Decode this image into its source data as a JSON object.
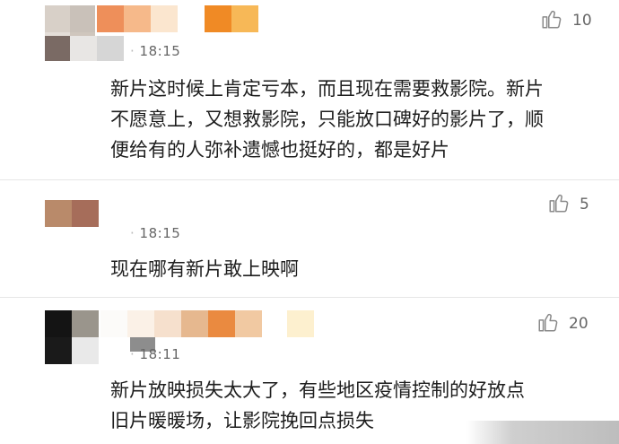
{
  "comments": [
    {
      "time": "18:15",
      "time_prefix": "",
      "likes": "10",
      "lines": [
        "新片这时候上肯定亏本，而且现在需要救影院。新片",
        "不愿意上，又想救影院，只能放口碑好的影片了，顺",
        "便给有的人弥补遗憾也挺好的，都是好片"
      ]
    },
    {
      "time": "18:15",
      "time_prefix": "",
      "likes": "5",
      "lines": [
        "现在哪有新片敢上映啊"
      ]
    },
    {
      "time": "18:11",
      "time_prefix": "",
      "likes": "20",
      "lines": [
        "新片放映损失太大了，有些地区疫情控制的好放点",
        "旧片暖暖场，让影院挽回点损失"
      ]
    }
  ],
  "colors": {
    "text": "#1e1e1e",
    "meta": "#666666",
    "divider": "#e6e6e6"
  },
  "icons": {
    "like": "thumbs-up-outline-icon"
  }
}
